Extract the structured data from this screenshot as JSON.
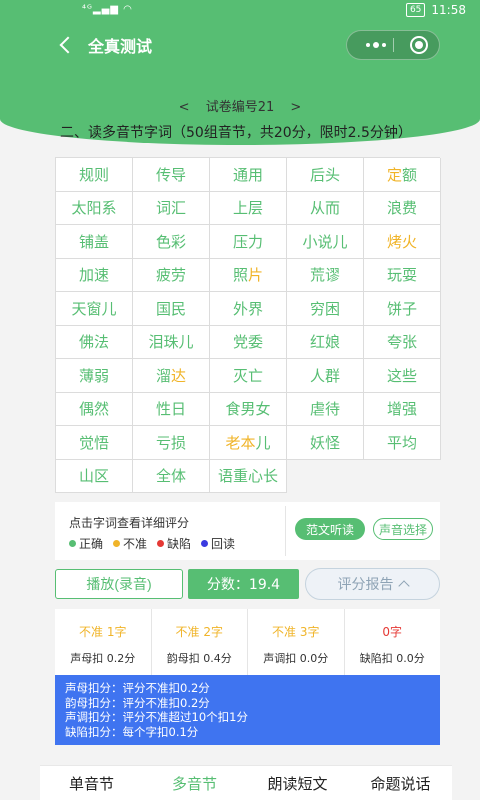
{
  "status": {
    "signal": "⁴ᴳ▂▄▆ ◠",
    "battery": "65",
    "time": "11:58"
  },
  "header": {
    "title": "全真测试"
  },
  "paper": {
    "prev": "<",
    "label": "试卷编号21",
    "next": ">"
  },
  "section_title": "二、读多音节字词（50组音节，共20分，限时2.5分钟）",
  "words": [
    [
      {
        "t": "规则"
      }
    ],
    [
      {
        "t": "传导"
      }
    ],
    [
      {
        "t": "通用"
      }
    ],
    [
      {
        "t": "后头"
      }
    ],
    [
      {
        "t": "定",
        "y": true
      },
      {
        "t": "额"
      }
    ],
    [
      {
        "t": "太阳系"
      }
    ],
    [
      {
        "t": "词汇"
      }
    ],
    [
      {
        "t": "上层"
      }
    ],
    [
      {
        "t": "从而"
      }
    ],
    [
      {
        "t": "浪费"
      }
    ],
    [
      {
        "t": "铺盖"
      }
    ],
    [
      {
        "t": "色彩"
      }
    ],
    [
      {
        "t": "压力"
      }
    ],
    [
      {
        "t": "小说儿"
      }
    ],
    [
      {
        "t": "烤火",
        "y": true
      }
    ],
    [
      {
        "t": "加速"
      }
    ],
    [
      {
        "t": "疲劳"
      }
    ],
    [
      {
        "t": "照"
      },
      {
        "t": "片",
        "y": true
      }
    ],
    [
      {
        "t": "荒谬"
      }
    ],
    [
      {
        "t": "玩耍"
      }
    ],
    [
      {
        "t": "天窗儿"
      }
    ],
    [
      {
        "t": "国民"
      }
    ],
    [
      {
        "t": "外界"
      }
    ],
    [
      {
        "t": "穷困"
      }
    ],
    [
      {
        "t": "饼子"
      }
    ],
    [
      {
        "t": "佛法"
      }
    ],
    [
      {
        "t": "泪珠儿"
      }
    ],
    [
      {
        "t": "党委"
      }
    ],
    [
      {
        "t": "红娘"
      }
    ],
    [
      {
        "t": "夸张"
      }
    ],
    [
      {
        "t": "薄弱"
      }
    ],
    [
      {
        "t": "溜"
      },
      {
        "t": "达",
        "y": true
      }
    ],
    [
      {
        "t": "灭亡"
      }
    ],
    [
      {
        "t": "人群"
      }
    ],
    [
      {
        "t": "这些"
      }
    ],
    [
      {
        "t": "偶然"
      }
    ],
    [
      {
        "t": "性日"
      }
    ],
    [
      {
        "t": "食男女"
      }
    ],
    [
      {
        "t": "虐待"
      }
    ],
    [
      {
        "t": "增强"
      }
    ],
    [
      {
        "t": "觉悟"
      }
    ],
    [
      {
        "t": "亏损"
      }
    ],
    [
      {
        "t": "老本",
        "y": true
      },
      {
        "t": "儿"
      }
    ],
    [
      {
        "t": "妖怪"
      }
    ],
    [
      {
        "t": "平均"
      }
    ],
    [
      {
        "t": "山区"
      }
    ],
    [
      {
        "t": "全体"
      }
    ],
    [
      {
        "t": "语重心长"
      }
    ]
  ],
  "legend": {
    "hint": "点击字词查看详细评分",
    "items": [
      {
        "label": "正确",
        "color": "#57be73"
      },
      {
        "label": "不准",
        "color": "#f0b429"
      },
      {
        "label": "缺陷",
        "color": "#e53935"
      },
      {
        "label": "回读",
        "color": "#3a3ae0"
      }
    ],
    "fanwen_label": "范文听读",
    "voice_label": "声音选择"
  },
  "actions": {
    "play_label": "播放(录音)",
    "score": "分数：19.4",
    "report_label": "评分报告"
  },
  "stats": [
    {
      "value": "不准 1字",
      "label": "声母扣 0.2分",
      "color": "yellow"
    },
    {
      "value": "不准 2字",
      "label": "韵母扣 0.4分",
      "color": "yellow"
    },
    {
      "value": "不准 3字",
      "label": "声调扣 0.0分",
      "color": "yellow"
    },
    {
      "value": "0字",
      "label": "缺陷扣 0.0分",
      "color": "red"
    }
  ],
  "rules": [
    "声母扣分：评分不准扣0.2分",
    "韵母扣分：评分不准扣0.2分",
    "声调扣分：评分不准超过10个扣1分",
    "缺陷扣分：每个字扣0.1分"
  ],
  "nav": [
    {
      "label": "单音节",
      "active": false
    },
    {
      "label": "多音节",
      "active": true
    },
    {
      "label": "朗读短文",
      "active": false
    },
    {
      "label": "命题说话",
      "active": false
    }
  ]
}
